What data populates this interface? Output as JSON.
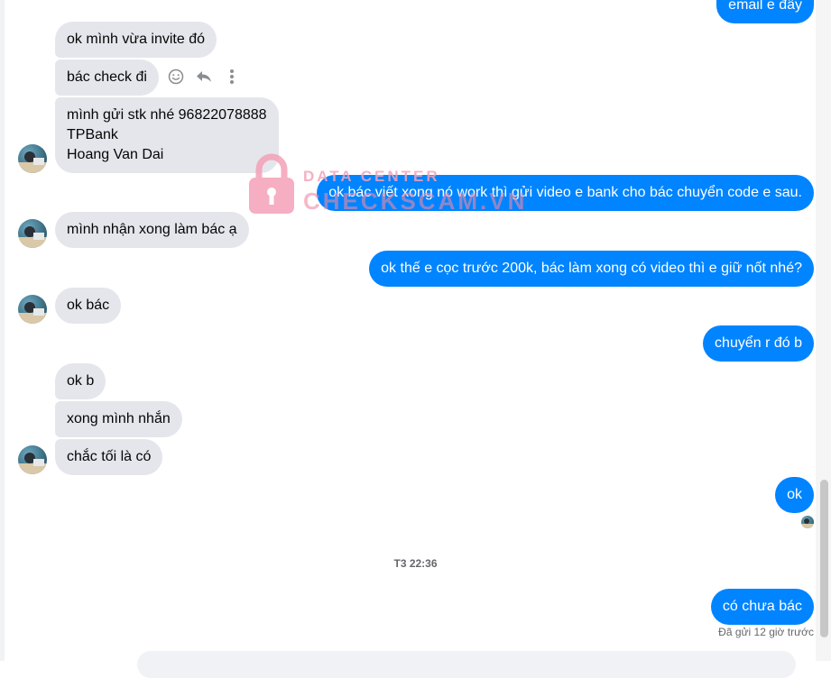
{
  "conversation": {
    "incoming": [
      {
        "text": "ok mình vừa invite đó"
      },
      {
        "text": "bác check đi"
      },
      {
        "lines": [
          "mình gửi stk nhé 96822078888",
          "TPBank",
          "Hoang Van Dai"
        ]
      },
      {
        "text": "mình nhận xong làm bác ạ"
      },
      {
        "text": "ok bác"
      },
      {
        "text": "ok b"
      },
      {
        "text": "xong mình nhắn"
      },
      {
        "text": "chắc tối là có"
      }
    ],
    "outgoing": [
      {
        "text": "email e đây"
      },
      {
        "text": "ok bác viết xong nó work thì gửi video e bank cho bác chuyển code e sau."
      },
      {
        "text": "ok thế e cọc trước 200k, bác làm xong có video thì e giữ nốt nhé?"
      },
      {
        "text": "chuyển r đó b"
      },
      {
        "text": "ok"
      },
      {
        "text": "có chưa bác"
      }
    ],
    "timestamp": "T3 22:36",
    "sent_status": "Đã gửi 12 giờ trước"
  },
  "hover_actions": [
    "react-icon",
    "reply-icon",
    "more-options-icon"
  ],
  "watermark": {
    "line1": "DATA CENTER",
    "line2": "CHECKSCAM.VN"
  },
  "colors": {
    "outgoing_bubble": "#0084ff",
    "incoming_bubble": "#e4e6eb",
    "watermark": "#f08aa6"
  }
}
